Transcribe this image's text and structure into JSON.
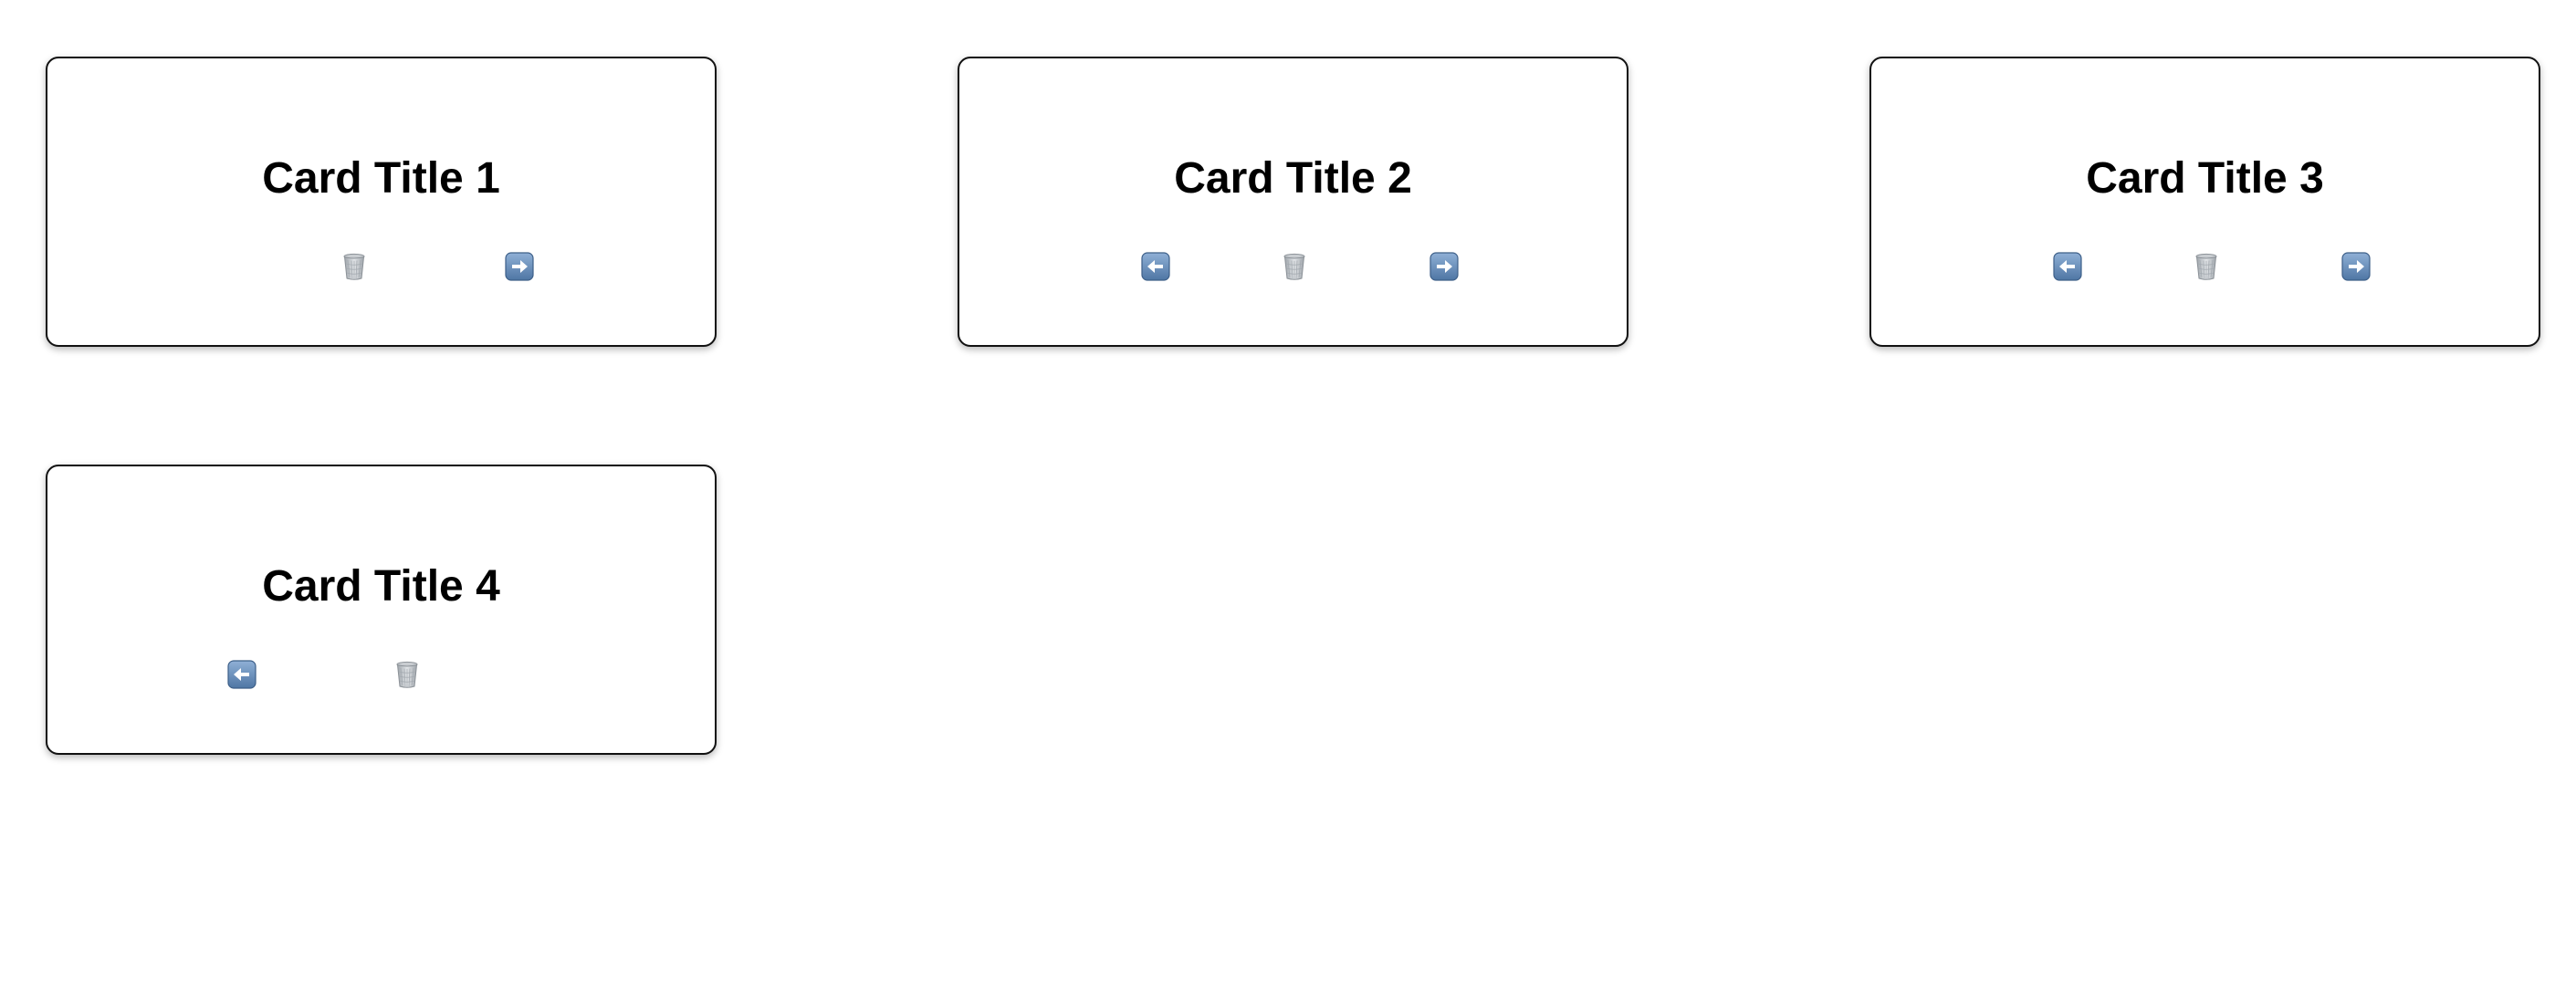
{
  "cards": [
    {
      "title": "Card Title 1",
      "buttons": [
        "trash-icon",
        "arrow-right-icon"
      ]
    },
    {
      "title": "Card Title 2",
      "buttons": [
        "arrow-left-icon",
        "trash-icon",
        "arrow-right-icon"
      ]
    },
    {
      "title": "Card Title 3",
      "buttons": [
        "arrow-left-icon",
        "trash-icon",
        "arrow-right-icon"
      ]
    },
    {
      "title": "Card Title 4",
      "buttons": [
        "arrow-left-icon",
        "trash-icon"
      ]
    }
  ],
  "colors": {
    "arrow_button": "#5f86b3",
    "trash": "#b7bcc2",
    "card_border": "#111111"
  }
}
